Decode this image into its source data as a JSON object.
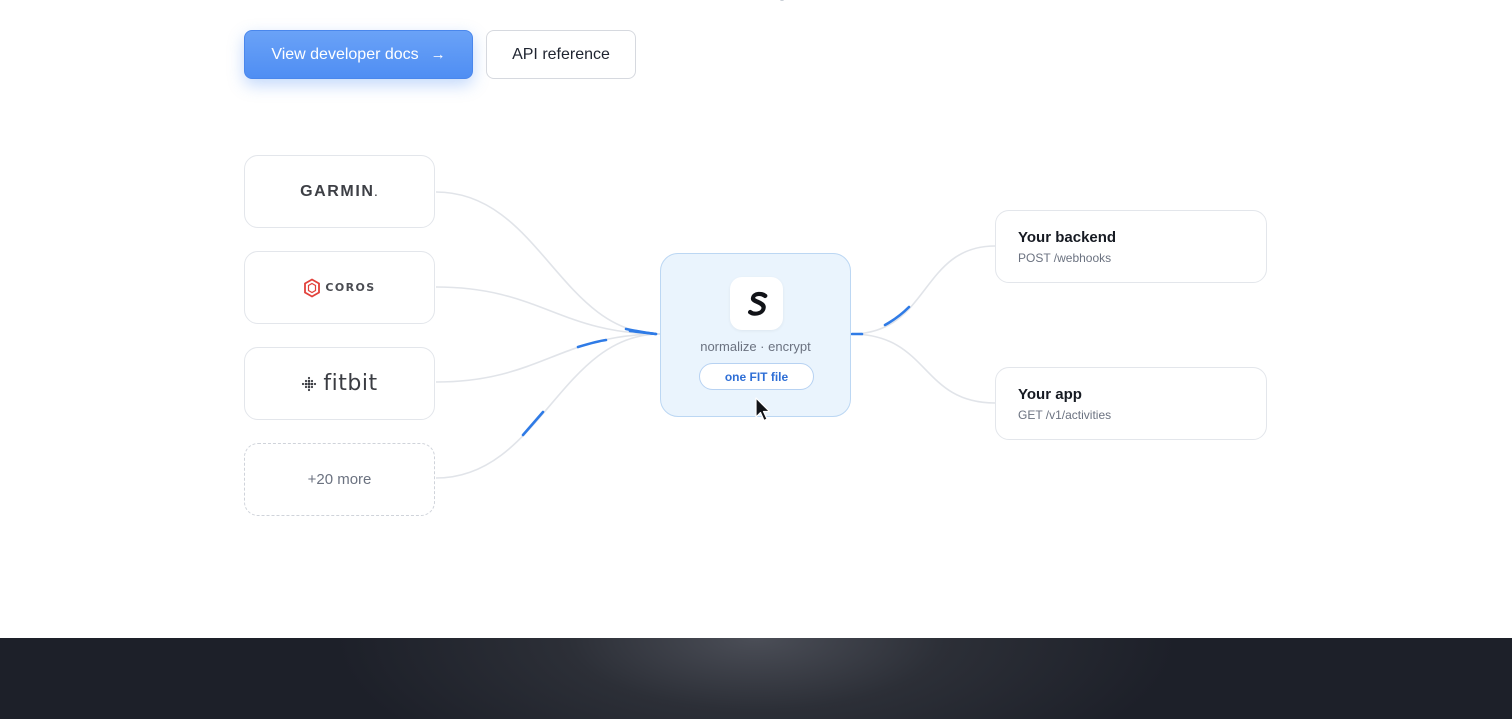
{
  "actions": {
    "primary_label": "View developer docs",
    "primary_arrow": "→",
    "secondary_label": "API reference"
  },
  "sources": [
    {
      "name": "GARMIN",
      "mark": ".",
      "icon": "garmin-logo"
    },
    {
      "name": "COROS",
      "icon": "coros-logo"
    },
    {
      "name": "fitbit",
      "icon": "fitbit-logo"
    },
    {
      "name": "+20 more",
      "icon": ""
    }
  ],
  "hub": {
    "logo_letter": "S",
    "caption": "normalize · encrypt",
    "output_label": "one FIT file"
  },
  "destinations": [
    {
      "title": "Your backend",
      "endpoint": "POST /webhooks"
    },
    {
      "title": "Your app",
      "endpoint": "GET /v1/activities"
    }
  ],
  "colors": {
    "accent": "#4f8ef3",
    "flow_line": "#e1e4e9",
    "flow_pulse": "#2f7be6",
    "hub_bg": "#eaf4fd",
    "hub_border": "#bcd7f3",
    "coros_red": "#e2413b",
    "footer_dark": "#1d2029"
  }
}
